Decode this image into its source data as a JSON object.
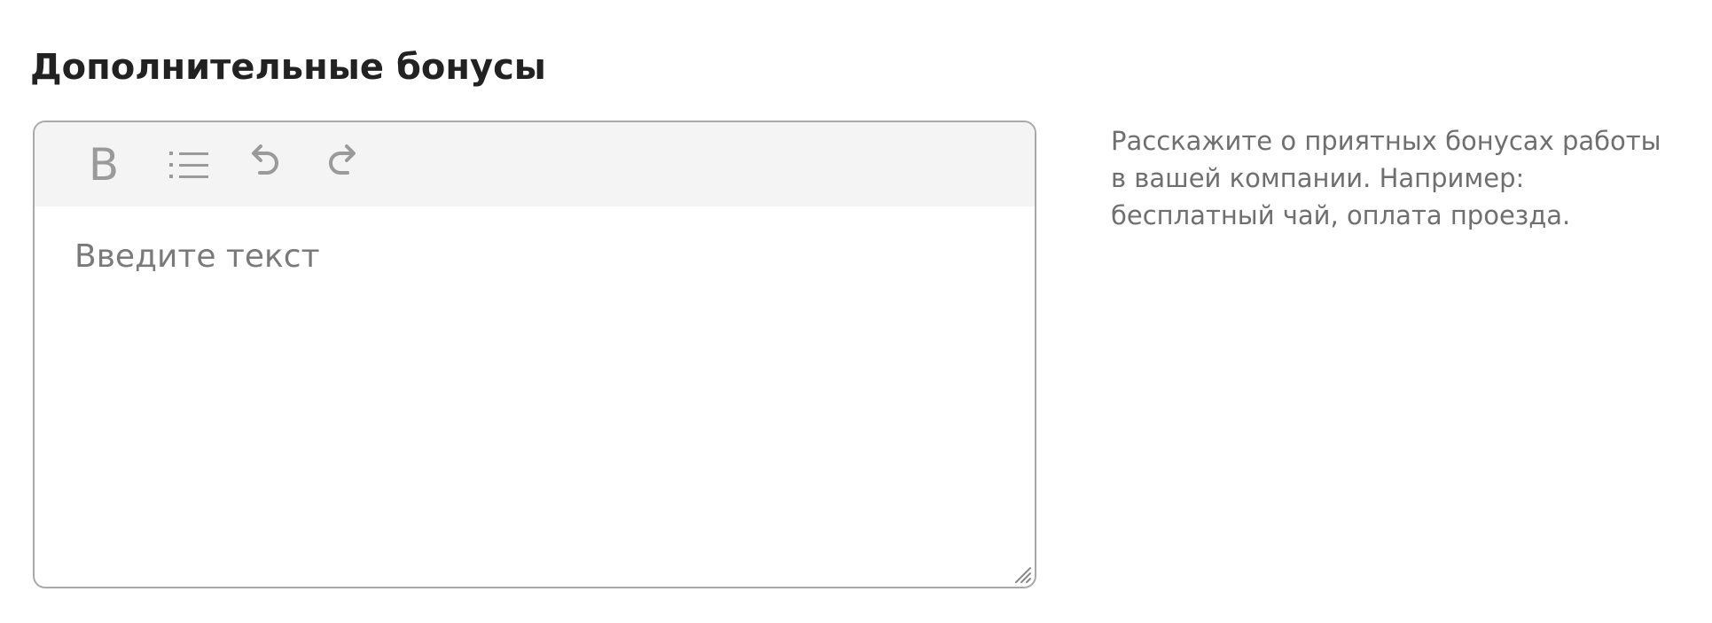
{
  "section": {
    "title": "Дополнительные бонусы"
  },
  "editor": {
    "toolbar": {
      "bold_label": "B",
      "icons": [
        "bold-icon",
        "bullet-list-icon",
        "undo-icon",
        "redo-icon"
      ]
    },
    "placeholder": "Введите текст",
    "value": ""
  },
  "hint": {
    "text": "Расскажите о приятных бонусах работы в вашей компании. Например: бесплатный чай, оплата проезда."
  },
  "colors": {
    "toolbar_background": "#f4f4f4",
    "border": "#a9a9a9",
    "icon": "#9a9a9a",
    "hint_text": "#6f6f6f",
    "title_text": "#222222"
  }
}
